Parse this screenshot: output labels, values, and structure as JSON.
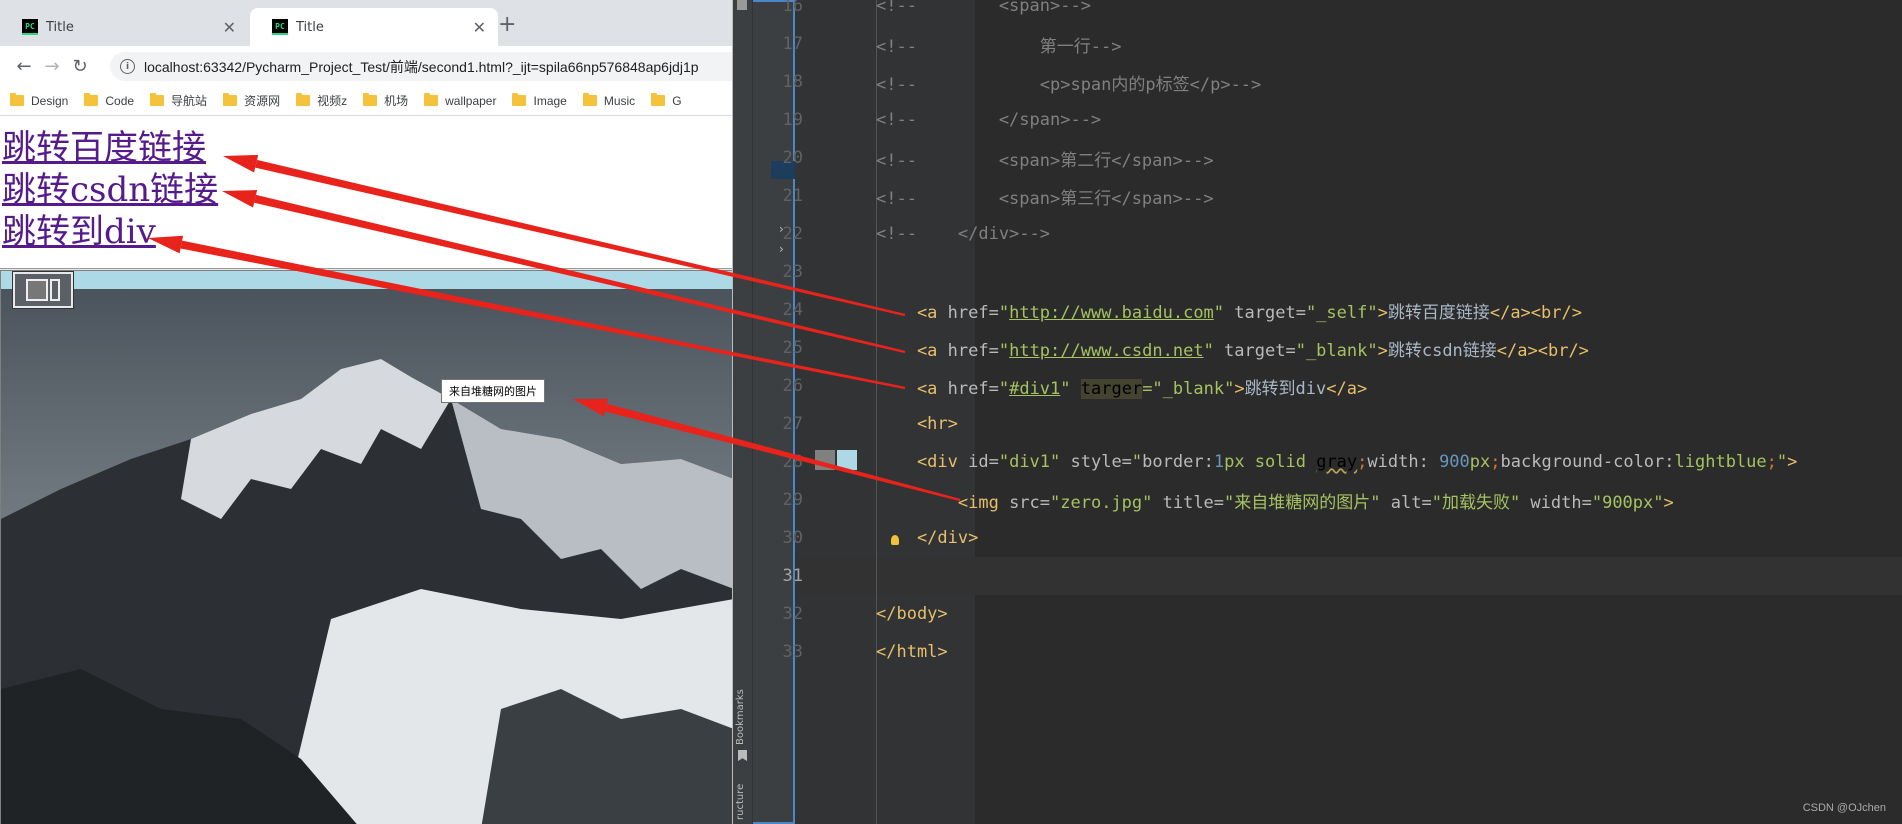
{
  "browser": {
    "tabs": [
      {
        "title": "Title"
      },
      {
        "title": "Title"
      }
    ],
    "favicon_text": "PC",
    "url": "localhost:63342/Pycharm_Project_Test/前端/second1.html?_ijt=spila66np576848ap6jdj1p",
    "bookmarks": [
      "Design",
      "Code",
      "导航站",
      "资源网",
      "视频z",
      "机场",
      "wallpaper",
      "Image",
      "Music",
      "G"
    ],
    "links": [
      "跳转百度链接",
      "跳转csdn链接",
      "跳转到div"
    ],
    "image_tooltip": "来自堆糖网的图片"
  },
  "ide": {
    "tool_windows": [
      "Bookmarks",
      "ructure"
    ],
    "current_line": 31,
    "lines": [
      {
        "n": "16",
        "tokens": [
          {
            "t": "cm",
            "v": "<!--        <span>-->"
          }
        ]
      },
      {
        "n": "17",
        "tokens": [
          {
            "t": "cm",
            "v": "<!--            第一行-->"
          }
        ]
      },
      {
        "n": "18",
        "tokens": [
          {
            "t": "cm",
            "v": "<!--            <p>span内的p标签</p>-->"
          }
        ]
      },
      {
        "n": "19",
        "tokens": [
          {
            "t": "cm",
            "v": "<!--        </span>-->"
          }
        ]
      },
      {
        "n": "20",
        "tokens": [
          {
            "t": "cm",
            "v": "<!--        <span>第二行</span>-->"
          }
        ]
      },
      {
        "n": "21",
        "tokens": [
          {
            "t": "cm",
            "v": "<!--        <span>第三行</span>-->"
          }
        ]
      },
      {
        "n": "22",
        "tokens": [
          {
            "t": "cm",
            "v": "<!--    </div>-->"
          }
        ]
      },
      {
        "n": "23",
        "tokens": []
      },
      {
        "n": "24",
        "tokens": [
          {
            "t": "tg",
            "v": "    <a "
          },
          {
            "t": "at",
            "v": "href="
          },
          {
            "t": "sv",
            "v": "\""
          },
          {
            "t": "url",
            "v": "http://www.baidu.com"
          },
          {
            "t": "sv",
            "v": "\""
          },
          {
            "t": "at",
            "v": " target="
          },
          {
            "t": "sv",
            "v": "\"_self\""
          },
          {
            "t": "tg",
            "v": ">"
          },
          {
            "t": "tx",
            "v": "跳转百度链接"
          },
          {
            "t": "tg",
            "v": "</a><br/>"
          }
        ]
      },
      {
        "n": "25",
        "tokens": [
          {
            "t": "tg",
            "v": "    <a "
          },
          {
            "t": "at",
            "v": "href="
          },
          {
            "t": "sv",
            "v": "\""
          },
          {
            "t": "url",
            "v": "http://www.csdn.net"
          },
          {
            "t": "sv",
            "v": "\""
          },
          {
            "t": "at",
            "v": " target="
          },
          {
            "t": "sv",
            "v": "\"_blank\""
          },
          {
            "t": "tg",
            "v": ">"
          },
          {
            "t": "tx",
            "v": "跳转csdn链接"
          },
          {
            "t": "tg",
            "v": "</a><br/>"
          }
        ]
      },
      {
        "n": "26",
        "tokens": [
          {
            "t": "tg",
            "v": "    <a "
          },
          {
            "t": "at",
            "v": "href="
          },
          {
            "t": "sv",
            "v": "\""
          },
          {
            "t": "url",
            "v": "#div1"
          },
          {
            "t": "sv",
            "v": "\" "
          },
          {
            "t": "hl",
            "v": "targer"
          },
          {
            "t": "sv",
            "v": "=\"_blank\""
          },
          {
            "t": "tg",
            "v": ">"
          },
          {
            "t": "tx",
            "v": "跳转到div"
          },
          {
            "t": "tg",
            "v": "</a>"
          }
        ]
      },
      {
        "n": "27",
        "tokens": [
          {
            "t": "tg",
            "v": "    <hr>"
          }
        ]
      },
      {
        "n": "28",
        "tokens": [
          {
            "t": "tg",
            "v": "    <div "
          },
          {
            "t": "at",
            "v": "id="
          },
          {
            "t": "sv",
            "v": "\"div1\""
          },
          {
            "t": "at",
            "v": " style="
          },
          {
            "t": "sv",
            "v": "\""
          },
          {
            "t": "at",
            "v": "border:"
          },
          {
            "t": "nm",
            "v": "1"
          },
          {
            "t": "sv",
            "v": "px solid "
          },
          {
            "t": "warn",
            "v": "gray"
          },
          {
            "t": "kw",
            "v": ";"
          },
          {
            "t": "at",
            "v": "width: "
          },
          {
            "t": "nm",
            "v": "900"
          },
          {
            "t": "sv",
            "v": "px"
          },
          {
            "t": "kw",
            "v": ";"
          },
          {
            "t": "at",
            "v": "background-color:"
          },
          {
            "t": "sv",
            "v": "lightblue"
          },
          {
            "t": "kw",
            "v": ";"
          },
          {
            "t": "sv",
            "v": "\""
          },
          {
            "t": "tg",
            "v": ">"
          }
        ]
      },
      {
        "n": "29",
        "tokens": [
          {
            "t": "tg",
            "v": "        <img "
          },
          {
            "t": "at",
            "v": "src="
          },
          {
            "t": "sv",
            "v": "\"zero.jpg\""
          },
          {
            "t": "at",
            "v": " title="
          },
          {
            "t": "sv",
            "v": "\"来自堆糖网的图片\""
          },
          {
            "t": "at",
            "v": " alt="
          },
          {
            "t": "sv",
            "v": "\"加载失败\""
          },
          {
            "t": "at",
            "v": " width="
          },
          {
            "t": "sv",
            "v": "\"900px\""
          },
          {
            "t": "tg",
            "v": ">"
          }
        ]
      },
      {
        "n": "30",
        "tokens": [
          {
            "t": "tg",
            "v": "    </div>"
          }
        ]
      },
      {
        "n": "31",
        "tokens": []
      },
      {
        "n": "32",
        "tokens": [
          {
            "t": "tg",
            "v": "</body>"
          }
        ]
      },
      {
        "n": "33",
        "tokens": [
          {
            "t": "tg",
            "v": "</html>"
          }
        ]
      }
    ],
    "watermark": "CSDN @OJchen"
  },
  "colors": {
    "arrow": "#e8231b",
    "link_visited": "#551a8b"
  }
}
